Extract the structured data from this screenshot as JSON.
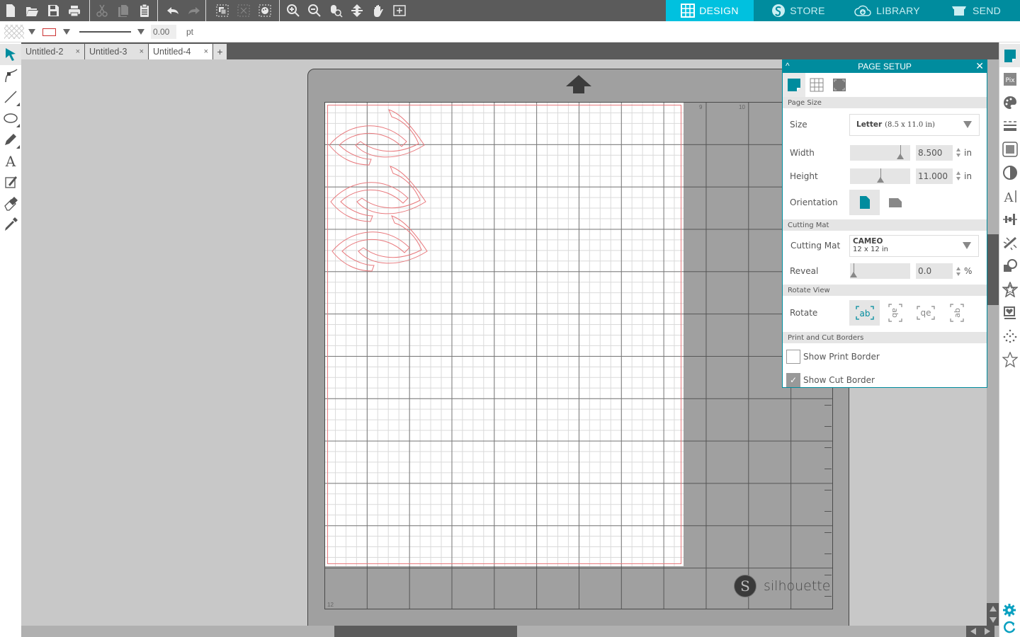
{
  "toolbar": {
    "file_icons": [
      "new-document-icon",
      "open-folder-icon",
      "save-icon",
      "print-icon"
    ],
    "edit_icons": [
      "cut-icon",
      "copy-icon",
      "paste-icon"
    ],
    "undo_icons": [
      "undo-icon",
      "redo-icon"
    ],
    "group_icons": [
      "group-icon",
      "ungroup-icon",
      "release-compound-icon"
    ],
    "view_icons": [
      "zoom-in-icon",
      "zoom-out-icon",
      "zoom-select-icon",
      "fit-to-page-icon",
      "pan-icon",
      "fit-to-window-icon"
    ]
  },
  "modes": [
    {
      "label": "DESIGN",
      "icon": "grid-icon",
      "active": true
    },
    {
      "label": "STORE",
      "icon": "store-icon",
      "active": false
    },
    {
      "label": "LIBRARY",
      "icon": "cloud-library-icon",
      "active": false
    },
    {
      "label": "SEND",
      "icon": "cutter-icon",
      "active": false
    }
  ],
  "linebar": {
    "fill_icon": "fill-pattern-icon",
    "stroke_color": "#cc3333",
    "line_width_value": "0.00",
    "line_width_unit": "pt"
  },
  "doc_tabs": [
    {
      "label": "Untitled-2",
      "active": false
    },
    {
      "label": "Untitled-3",
      "active": false
    },
    {
      "label": "Untitled-4",
      "active": true
    }
  ],
  "doc_tab_close": "×",
  "doc_tab_add": "+",
  "left_tools": [
    "select-tool-icon",
    "edit-points-icon",
    "line-tool-icon",
    "ellipse-tool-icon",
    "pencil-tool-icon",
    "text-tool-icon",
    "knife-tool-icon",
    "eraser-tool-icon",
    "eyedropper-tool-icon"
  ],
  "right_tools": [
    "page-setup-icon",
    "pixscan-icon",
    "fill-panel-icon",
    "line-style-icon",
    "offset-icon",
    "trace-icon",
    "text-style-icon",
    "transform-icon",
    "replicate-icon",
    "modify-icon",
    "offset-star-icon",
    "print-cut-icon",
    "sketch-icon",
    "favorites-star-icon"
  ],
  "canvas": {
    "ruler_labels": {
      "x9": "9",
      "x10": "10",
      "y12": "12"
    },
    "brand": "silhouette",
    "brand_logo": "S"
  },
  "page_setup": {
    "title": "PAGE SETUP",
    "collapse": "^",
    "close": "✕",
    "sections": {
      "page_size": "Page Size",
      "cutting_mat": "Cutting Mat",
      "rotate_view": "Rotate View",
      "print_cut_borders": "Print and Cut Borders"
    },
    "size_label": "Size",
    "size_value_bold": "Letter",
    "size_value_detail": "(8.5 x 11.0 in)",
    "width_label": "Width",
    "width_value": "8.500",
    "width_unit": "in",
    "width_slider_fraction": 0.84,
    "height_label": "Height",
    "height_value": "11.000",
    "height_unit": "in",
    "height_slider_fraction": 0.5,
    "orientation_label": "Orientation",
    "orientation_options": [
      "portrait",
      "landscape"
    ],
    "orientation_selected": "portrait",
    "mat_label": "Cutting Mat",
    "mat_value_name": "CAMEO",
    "mat_value_size": "12 x 12 in",
    "reveal_label": "Reveal",
    "reveal_value": "0.0",
    "reveal_unit": "%",
    "reveal_slider_fraction": 0.0,
    "rotate_label": "Rotate",
    "rotate_options": [
      "ab",
      "ab",
      "qe",
      "ab"
    ],
    "rotate_selected": 0,
    "show_print_border_label": "Show Print Border",
    "show_print_border": false,
    "show_cut_border_label": "Show Cut Border",
    "show_cut_border": true,
    "checkmark": "✓"
  },
  "accent_color": "#008c9e",
  "active_mode_color": "#00c1df"
}
